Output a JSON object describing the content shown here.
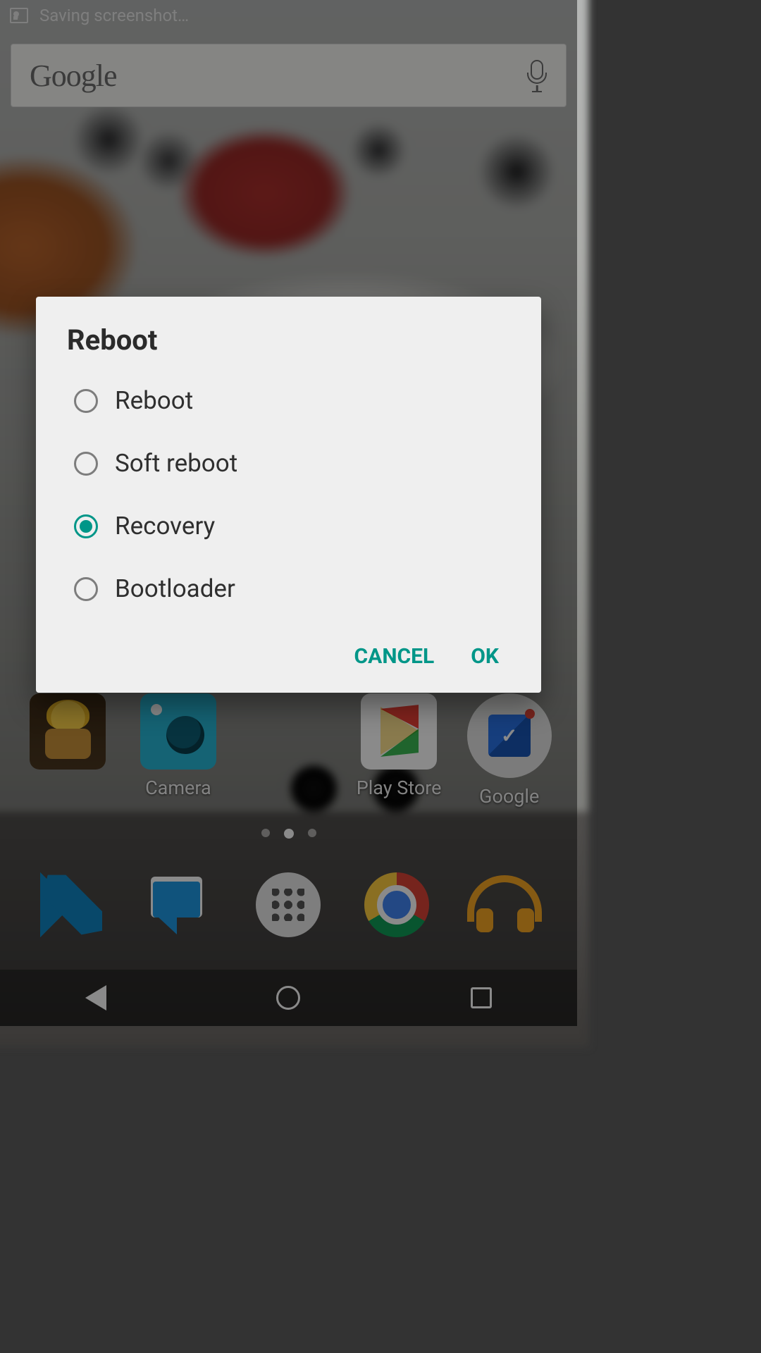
{
  "statusbar": {
    "text": "Saving screenshot…"
  },
  "search": {
    "logo": "Google"
  },
  "home_apps": [
    {
      "name": "clash-of-clans",
      "label": "",
      "show_label": false
    },
    {
      "name": "camera",
      "label": "Camera",
      "show_label": true
    },
    {
      "name": "spacer",
      "label": "",
      "show_label": false
    },
    {
      "name": "play-store",
      "label": "Play Store",
      "show_label": true
    },
    {
      "name": "google-folder",
      "label": "Google",
      "show_label": true
    }
  ],
  "page_indicator": {
    "count": 3,
    "active": 1
  },
  "dock": [
    {
      "name": "phone"
    },
    {
      "name": "messenger"
    },
    {
      "name": "app-drawer"
    },
    {
      "name": "chrome"
    },
    {
      "name": "play-music"
    }
  ],
  "dialog": {
    "title": "Reboot",
    "options": [
      {
        "label": "Reboot",
        "selected": false
      },
      {
        "label": "Soft reboot",
        "selected": false
      },
      {
        "label": "Recovery",
        "selected": true
      },
      {
        "label": "Bootloader",
        "selected": false
      }
    ],
    "cancel": "CANCEL",
    "ok": "OK"
  },
  "accent_color": "#009688"
}
